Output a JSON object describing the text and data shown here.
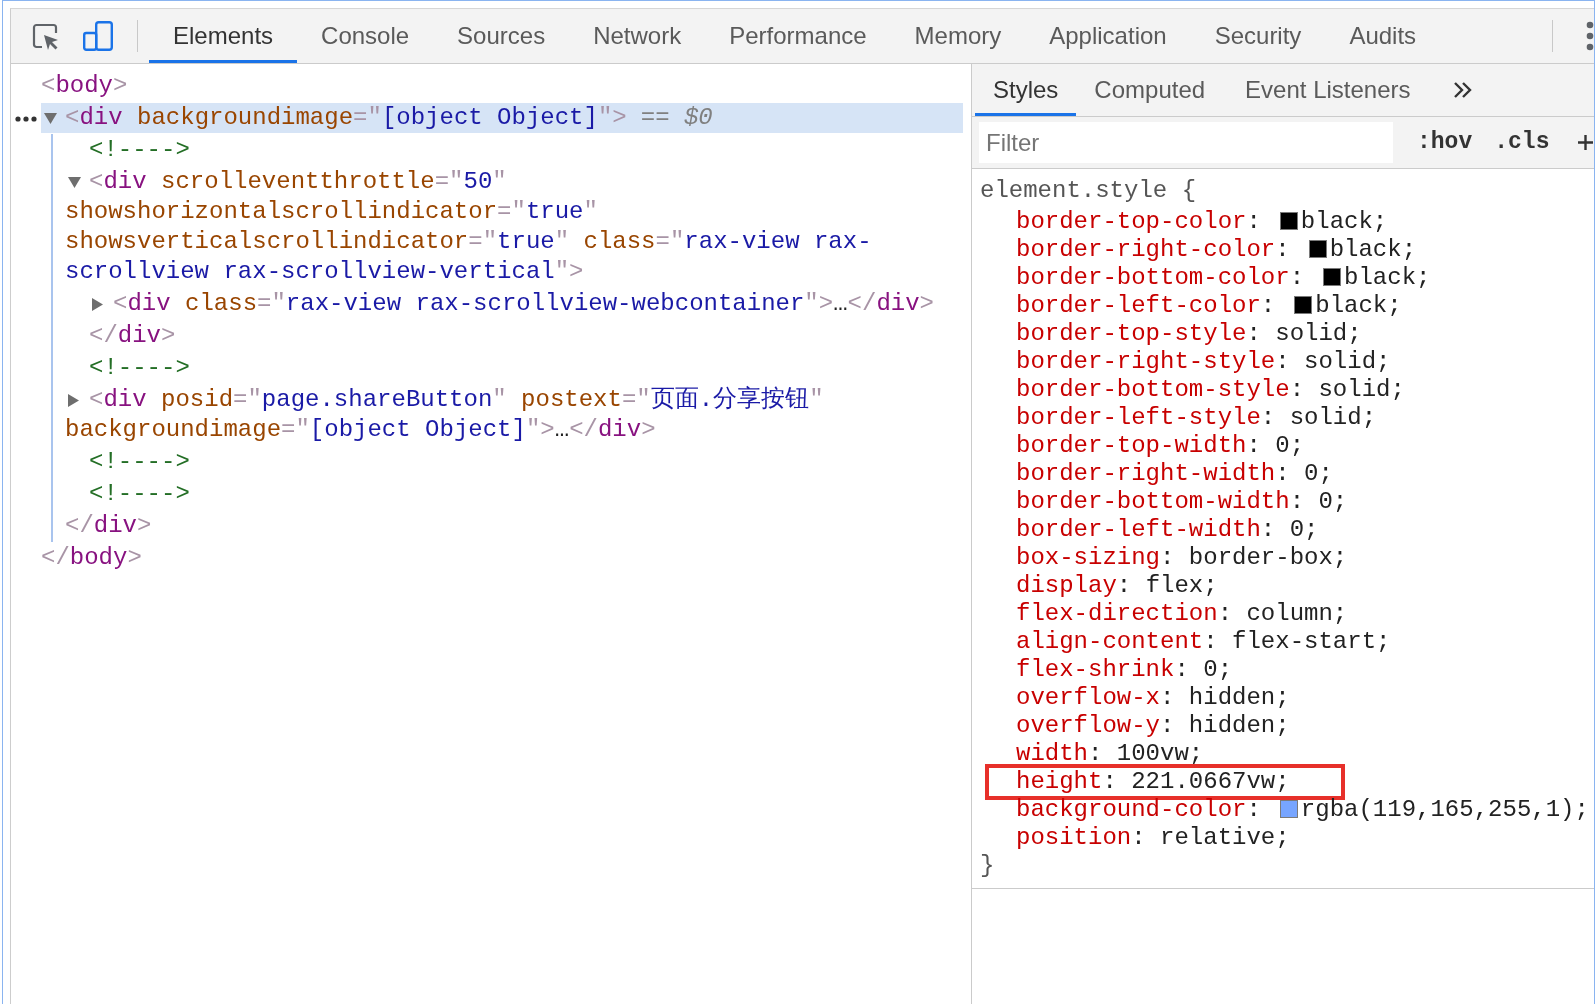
{
  "toolbar": {
    "device_toolbar": {
      "on": true
    },
    "tabs": [
      {
        "label": "Elements",
        "selected": true
      },
      {
        "label": "Console",
        "selected": false
      },
      {
        "label": "Sources",
        "selected": false
      },
      {
        "label": "Network",
        "selected": false
      },
      {
        "label": "Performance",
        "selected": false
      },
      {
        "label": "Memory",
        "selected": false
      },
      {
        "label": "Application",
        "selected": false
      },
      {
        "label": "Security",
        "selected": false
      },
      {
        "label": "Audits",
        "selected": false
      }
    ]
  },
  "elements_panel": {
    "tree": [
      {
        "kind": "element",
        "selected": false,
        "expanded": true,
        "open": [
          {
            "kind": "punct",
            "text": "<"
          },
          {
            "kind": "tag",
            "text": "body"
          },
          {
            "kind": "punct",
            "text": ">"
          }
        ],
        "children": [
          {
            "kind": "element",
            "selected": true,
            "expanded": true,
            "console_ref": "== *$0*",
            "open": [
              {
                "kind": "punct",
                "text": "<"
              },
              {
                "kind": "tag",
                "text": "div"
              },
              {
                "kind": "attr",
                "text": " backgroundimage"
              },
              {
                "kind": "punct",
                "text": "=\""
              },
              {
                "kind": "value",
                "text": "[object Object]"
              },
              {
                "kind": "punct",
                "text": "\">"
              }
            ],
            "children": [
              {
                "kind": "comment",
                "selected": false,
                "text": "<!---->"
              },
              {
                "kind": "element",
                "selected": false,
                "expanded": true,
                "open": [
                  {
                    "kind": "punct",
                    "text": "<"
                  },
                  {
                    "kind": "tag",
                    "text": "div"
                  },
                  {
                    "kind": "attr",
                    "text": " scrolleventthrottle"
                  },
                  {
                    "kind": "punct",
                    "text": "=\""
                  },
                  {
                    "kind": "value",
                    "text": "50"
                  },
                  {
                    "kind": "punct",
                    "text": "\""
                  },
                  {
                    "kind": "attr",
                    "text": " showshorizontalscrollindicator"
                  },
                  {
                    "kind": "punct",
                    "text": "=\""
                  },
                  {
                    "kind": "value",
                    "text": "true"
                  },
                  {
                    "kind": "punct",
                    "text": "\""
                  },
                  {
                    "kind": "attr",
                    "text": " showsverticalscrollindicator"
                  },
                  {
                    "kind": "punct",
                    "text": "=\""
                  },
                  {
                    "kind": "value",
                    "text": "true"
                  },
                  {
                    "kind": "punct",
                    "text": "\""
                  },
                  {
                    "kind": "attr",
                    "text": " class"
                  },
                  {
                    "kind": "punct",
                    "text": "=\""
                  },
                  {
                    "kind": "value",
                    "text": "rax-view rax-scrollview rax-scrollview-vertical"
                  },
                  {
                    "kind": "punct",
                    "text": "\">"
                  }
                ],
                "children": [
                  {
                    "kind": "element",
                    "selected": false,
                    "expanded": false,
                    "open": [
                      {
                        "kind": "punct",
                        "text": "<"
                      },
                      {
                        "kind": "tag",
                        "text": "div"
                      },
                      {
                        "kind": "attr",
                        "text": " class"
                      },
                      {
                        "kind": "punct",
                        "text": "=\""
                      },
                      {
                        "kind": "value",
                        "text": "rax-view rax-scrollview-webcontainer"
                      },
                      {
                        "kind": "punct",
                        "text": "\">"
                      }
                    ],
                    "ellipsis": "…",
                    "close": [
                      {
                        "kind": "punct",
                        "text": "</"
                      },
                      {
                        "kind": "tag",
                        "text": "div"
                      },
                      {
                        "kind": "punct",
                        "text": ">"
                      }
                    ]
                  }
                ],
                "close": [
                  {
                    "kind": "punct",
                    "text": "</"
                  },
                  {
                    "kind": "tag",
                    "text": "div"
                  },
                  {
                    "kind": "punct",
                    "text": ">"
                  }
                ]
              },
              {
                "kind": "comment",
                "selected": false,
                "text": "<!---->"
              },
              {
                "kind": "element",
                "selected": false,
                "expanded": false,
                "open": [
                  {
                    "kind": "punct",
                    "text": "<"
                  },
                  {
                    "kind": "tag",
                    "text": "div"
                  },
                  {
                    "kind": "attr",
                    "text": " posid"
                  },
                  {
                    "kind": "punct",
                    "text": "=\""
                  },
                  {
                    "kind": "value",
                    "text": "page.shareButton"
                  },
                  {
                    "kind": "punct",
                    "text": "\""
                  },
                  {
                    "kind": "attr",
                    "text": " postext"
                  },
                  {
                    "kind": "punct",
                    "text": "=\""
                  },
                  {
                    "kind": "value",
                    "text": "页面.分享按钮"
                  },
                  {
                    "kind": "punct",
                    "text": "\""
                  },
                  {
                    "kind": "attr",
                    "text": " backgroundimage"
                  },
                  {
                    "kind": "punct",
                    "text": "=\""
                  },
                  {
                    "kind": "value",
                    "text": "[object Object]"
                  },
                  {
                    "kind": "punct",
                    "text": "\">"
                  }
                ],
                "ellipsis": "…",
                "close": [
                  {
                    "kind": "punct",
                    "text": "</"
                  },
                  {
                    "kind": "tag",
                    "text": "div"
                  },
                  {
                    "kind": "punct",
                    "text": ">"
                  }
                ]
              },
              {
                "kind": "comment",
                "selected": false,
                "text": "<!---->"
              },
              {
                "kind": "comment",
                "selected": false,
                "text": "<!---->"
              }
            ],
            "close": [
              {
                "kind": "punct",
                "text": "</"
              },
              {
                "kind": "tag",
                "text": "div"
              },
              {
                "kind": "punct",
                "text": ">"
              }
            ]
          }
        ],
        "close": [
          {
            "kind": "punct",
            "text": "</"
          },
          {
            "kind": "tag",
            "text": "body"
          },
          {
            "kind": "punct",
            "text": ">"
          }
        ]
      }
    ]
  },
  "styles_pane": {
    "tabs": [
      {
        "label": "Styles",
        "selected": true
      },
      {
        "label": "Computed",
        "selected": false
      },
      {
        "label": "Event Listeners",
        "selected": false
      }
    ],
    "filter": {
      "placeholder": "Filter"
    },
    "buttons": [
      {
        "label": ":hov"
      },
      {
        "label": ".cls"
      }
    ],
    "rule": {
      "header": "element.style {",
      "declarations": [
        {
          "name": "border-top-color",
          "colon": ":",
          "color": "#000000",
          "value": "black;",
          "marked": false
        },
        {
          "name": "border-right-color",
          "colon": ":",
          "color": "#000000",
          "value": "black;",
          "marked": false
        },
        {
          "name": "border-bottom-color",
          "colon": ":",
          "color": "#000000",
          "value": "black;",
          "marked": false
        },
        {
          "name": "border-left-color",
          "colon": ":",
          "color": "#000000",
          "value": "black;",
          "marked": false
        },
        {
          "name": "border-top-style",
          "colon": ":",
          "value": "solid;",
          "marked": false
        },
        {
          "name": "border-right-style",
          "colon": ":",
          "value": "solid;",
          "marked": false
        },
        {
          "name": "border-bottom-style",
          "colon": ":",
          "value": "solid;",
          "marked": false
        },
        {
          "name": "border-left-style",
          "colon": ":",
          "value": "solid;",
          "marked": false
        },
        {
          "name": "border-top-width",
          "colon": ":",
          "value": "0;",
          "marked": false
        },
        {
          "name": "border-right-width",
          "colon": ":",
          "value": "0;",
          "marked": false
        },
        {
          "name": "border-bottom-width",
          "colon": ":",
          "value": "0;",
          "marked": false
        },
        {
          "name": "border-left-width",
          "colon": ":",
          "value": "0;",
          "marked": false
        },
        {
          "name": "box-sizing",
          "colon": ":",
          "value": "border-box;",
          "marked": false
        },
        {
          "name": "display",
          "colon": ":",
          "value": "flex;",
          "marked": false
        },
        {
          "name": "flex-direction",
          "colon": ":",
          "value": "column;",
          "marked": false
        },
        {
          "name": "align-content",
          "colon": ":",
          "value": "flex-start;",
          "marked": false
        },
        {
          "name": "flex-shrink",
          "colon": ":",
          "value": "0;",
          "marked": false
        },
        {
          "name": "overflow-x",
          "colon": ":",
          "value": "hidden;",
          "marked": false
        },
        {
          "name": "overflow-y",
          "colon": ":",
          "value": "hidden;",
          "marked": false
        },
        {
          "name": "width",
          "colon": ":",
          "value": "100vw;",
          "marked": false
        },
        {
          "name": "height",
          "colon": ":",
          "value": "221.0667vw;",
          "marked": true
        },
        {
          "name": "background-color",
          "colon": ":",
          "color": "#77a5ff",
          "value": "rgba(119,165,255,1);",
          "marked": false
        },
        {
          "name": "position",
          "colon": ":",
          "value": "relative;",
          "marked": false
        }
      ],
      "footer": "}"
    }
  }
}
